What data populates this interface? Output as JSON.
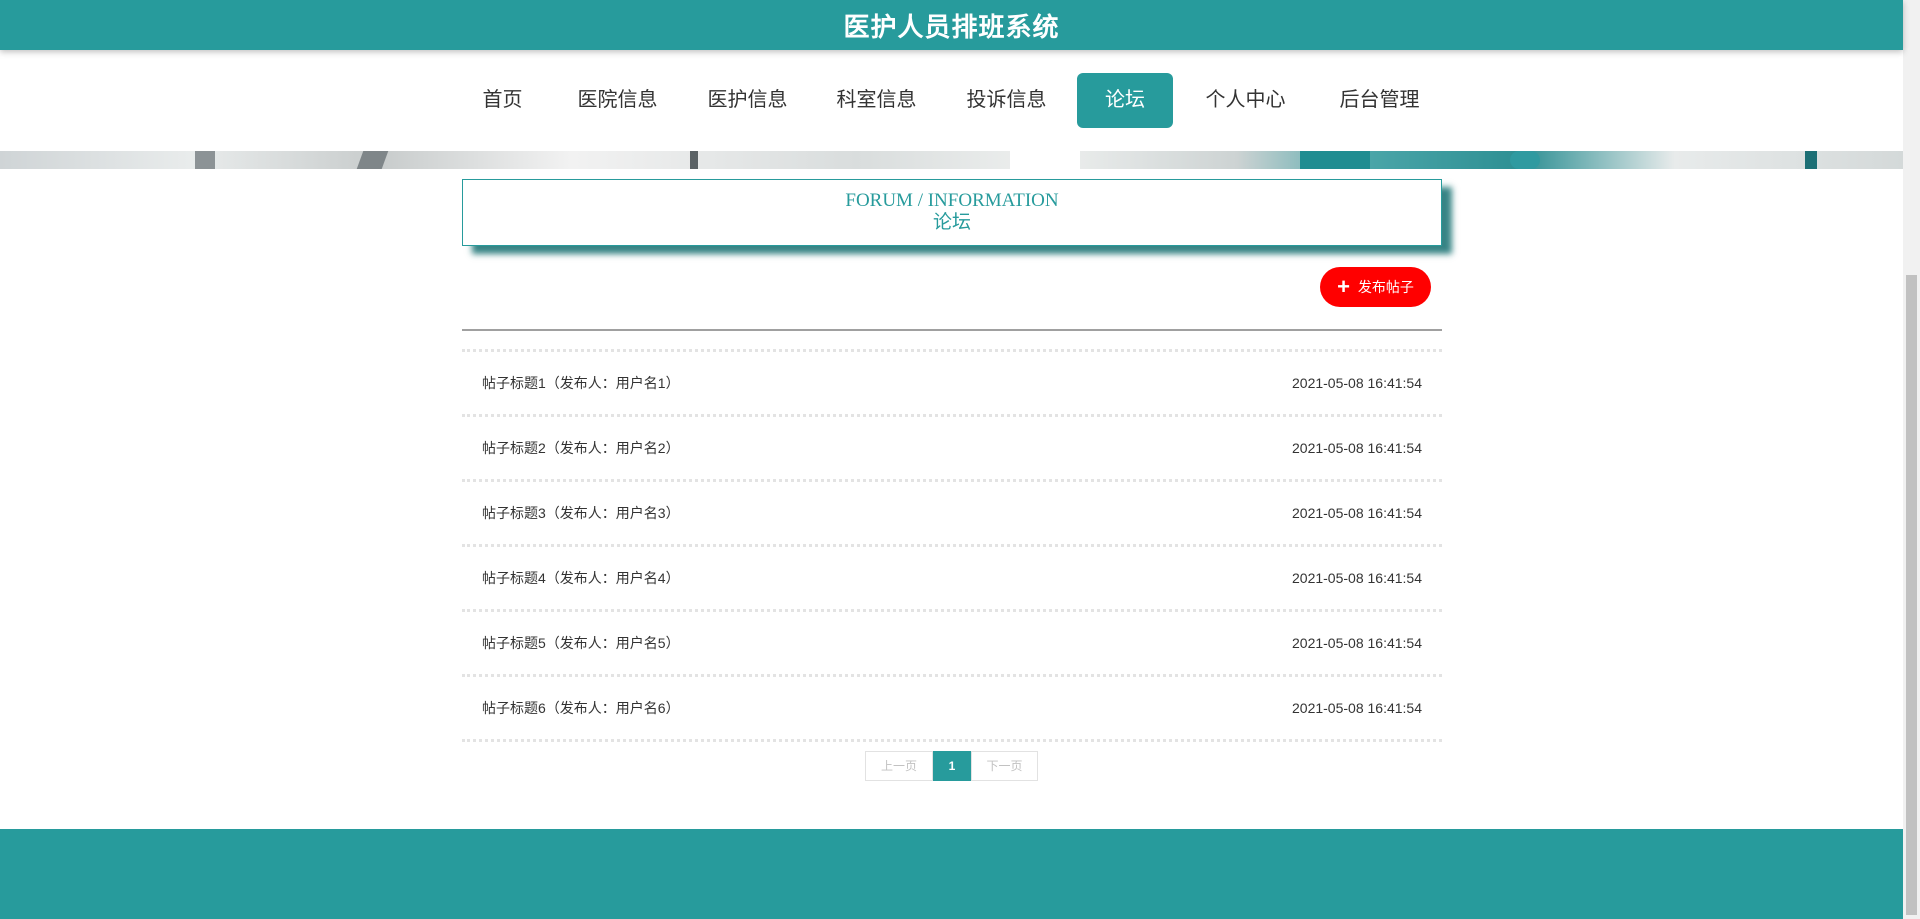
{
  "header": {
    "title": "医护人员排班系统"
  },
  "nav": {
    "items": [
      {
        "label": "首页",
        "active": false
      },
      {
        "label": "医院信息",
        "active": false
      },
      {
        "label": "医护信息",
        "active": false
      },
      {
        "label": "科室信息",
        "active": false
      },
      {
        "label": "投诉信息",
        "active": false
      },
      {
        "label": "论坛",
        "active": true
      },
      {
        "label": "个人中心",
        "active": false
      },
      {
        "label": "后台管理",
        "active": false
      }
    ]
  },
  "section": {
    "title_en": "FORUM / INFORMATION",
    "title_cn": "论坛"
  },
  "publish_button": {
    "icon": "plus-icon",
    "label": "发布帖子"
  },
  "posts": [
    {
      "title": "帖子标题1（发布人：用户名1）",
      "time": "2021-05-08 16:41:54"
    },
    {
      "title": "帖子标题2（发布人：用户名2）",
      "time": "2021-05-08 16:41:54"
    },
    {
      "title": "帖子标题3（发布人：用户名3）",
      "time": "2021-05-08 16:41:54"
    },
    {
      "title": "帖子标题4（发布人：用户名4）",
      "time": "2021-05-08 16:41:54"
    },
    {
      "title": "帖子标题5（发布人：用户名5）",
      "time": "2021-05-08 16:41:54"
    },
    {
      "title": "帖子标题6（发布人：用户名6）",
      "time": "2021-05-08 16:41:54"
    }
  ],
  "pagination": {
    "prev": "上一页",
    "current": "1",
    "next": "下一页"
  },
  "colors": {
    "primary": "#279b9c",
    "publish": "#ff0000"
  }
}
